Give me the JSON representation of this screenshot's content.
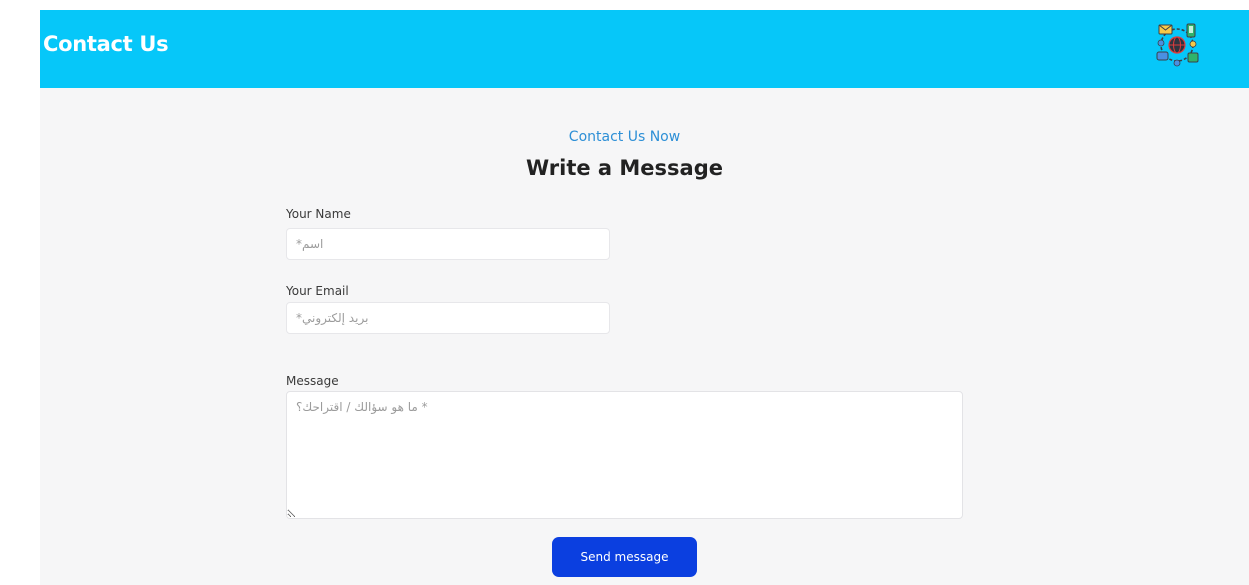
{
  "header": {
    "title": "Contact Us",
    "logo_icon": "globe-network-icon",
    "background_color": "#06c7f9"
  },
  "main": {
    "subtitle": "Contact Us Now",
    "title": "Write a Message",
    "subtitle_color": "#2d8fd6"
  },
  "form": {
    "name_label": "Your Name",
    "name_placeholder": "اسم*",
    "name_value": "",
    "email_label": "Your Email",
    "email_placeholder": "بريد إلكتروني*",
    "email_value": "",
    "message_label": "Message",
    "message_placeholder": "* ما هو سؤالك / اقتراحك؟",
    "message_value": "",
    "send_label": "Send message",
    "send_color": "#0b3fe0"
  }
}
